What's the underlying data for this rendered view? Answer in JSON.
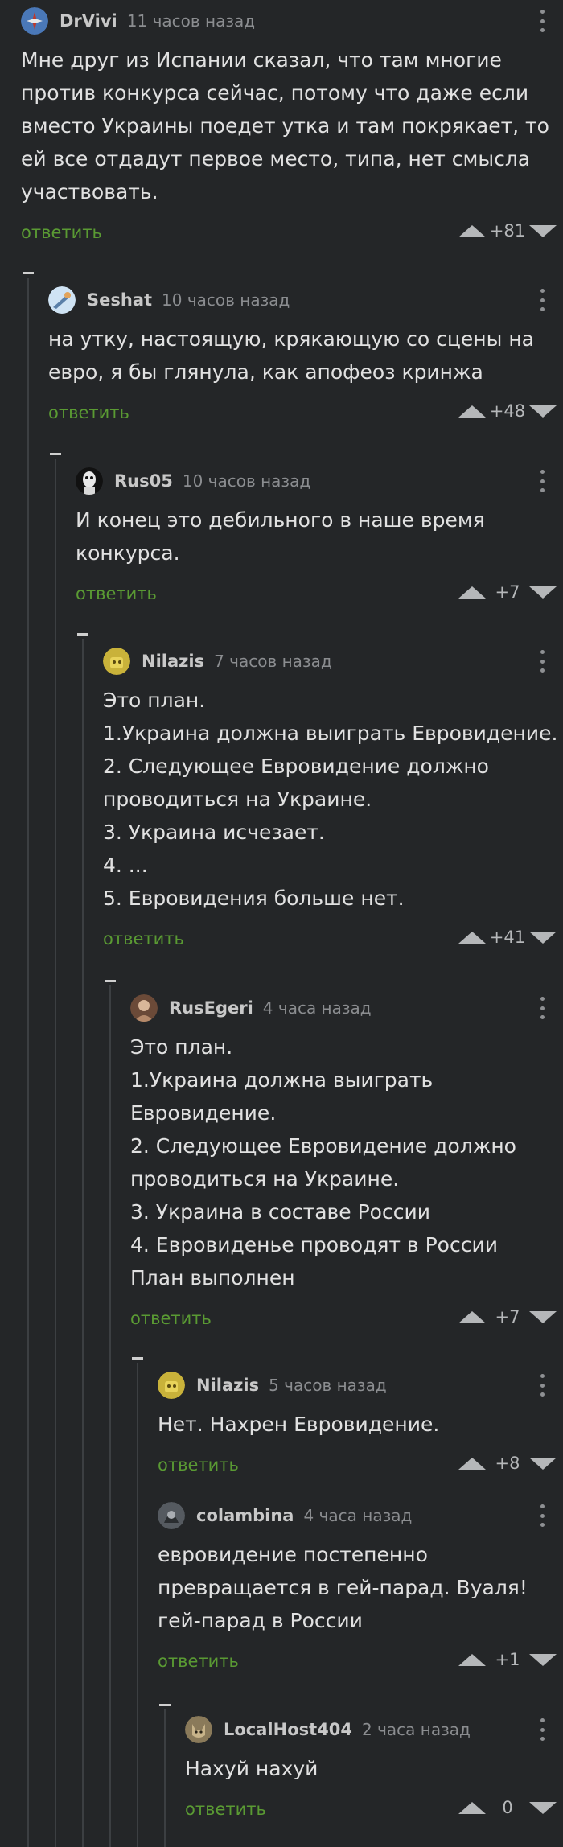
{
  "reply_label": "ответить",
  "colors": {
    "background": "#242628",
    "reply": "#5a9a33",
    "text": "#e1e1e1",
    "muted": "#8b8d90"
  },
  "comments": [
    {
      "author": "DrVivi",
      "time": "11 часов назад",
      "avatar_icon": "avatar-drvivi-icon",
      "text": "Мне друг из Испании сказал, что там многие\nпротив конкурса сейчас, потому что даже если\nвместо Украины поедет утка и там покрякает, то\nей все отдадут первое место, типа, нет смысла\nучаствовать.",
      "score": "+81"
    },
    {
      "author": "Seshat",
      "time": "10 часов назад",
      "avatar_icon": "avatar-seshat-icon",
      "text": "на утку, настоящую, крякающую со сцены на\nевро, я бы глянула, как апофеоз кринжа",
      "score": "+48"
    },
    {
      "author": "Rus05",
      "time": "10 часов назад",
      "avatar_icon": "avatar-rus05-icon",
      "text": "И конец это дебильного в наше время\nконкурса.",
      "score": "+7"
    },
    {
      "author": "Nilazis",
      "time": "7 часов назад",
      "avatar_icon": "avatar-nilazis-icon",
      "text": "Это план.\n1.Украина должна выиграть Евровидение.\n2. Следующее Евровидение должно\nпроводиться на Украине.\n3. Украина исчезает.\n4. ...\n5. Евровидения больше нет.",
      "score": "+41"
    },
    {
      "author": "RusEgeri",
      "time": "4 часа назад",
      "avatar_icon": "avatar-rusegeri-icon",
      "text": "Это план.\n1.Украина должна выиграть\nЕвровидение.\n2. Следующее Евровидение должно\nпроводиться на Украине.\n3. Украина в составе России\n4. Евровиденье проводят в России\nПлан выполнен",
      "score": "+7"
    },
    {
      "author": "Nilazis",
      "time": "5 часов назад",
      "avatar_icon": "avatar-nilazis-icon",
      "text": "Нет. Нахрен Евровидение.",
      "score": "+8"
    },
    {
      "author": "colambina",
      "time": "4 часа назад",
      "avatar_icon": "avatar-colambina-icon",
      "text": "евровидение постепенно\nпревращается в гей-парад. Вуаля!\nгей-парад в России",
      "score": "+1"
    },
    {
      "author": "LocalHost404",
      "time": "2 часа назад",
      "avatar_icon": "avatar-localhost404-icon",
      "text": "Нахуй нахуй",
      "score": "0"
    }
  ]
}
